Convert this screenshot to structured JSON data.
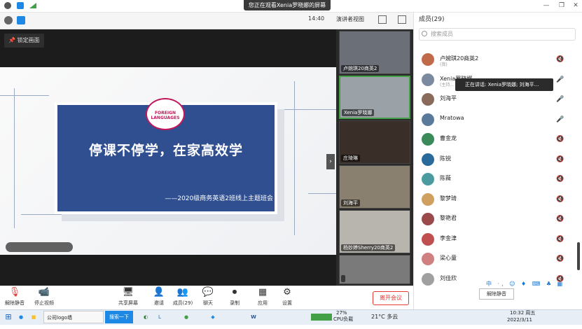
{
  "topbar": {
    "share_banner": "您正在观看Xenia罗晓娜的屏幕",
    "time": "14:40",
    "view_mode": "演讲者视图",
    "members_title": "成员(29)"
  },
  "stage": {
    "lock_label": "锁定画面",
    "slide_title": "停课不停学，在家高效学",
    "slide_subtitle": "——2020级商务英语2班线上主题班会",
    "logo_text": "FOREIGN LANGUAGES"
  },
  "filmstrip": [
    {
      "name": "卢婉琪20商英2"
    },
    {
      "name": "Xenia罗晓娜"
    },
    {
      "name": "庄琦琳"
    },
    {
      "name": "刘海平"
    },
    {
      "name": "杨妙婷Sherry20商英2"
    },
    {
      "name": ""
    }
  ],
  "bottombar": {
    "mute": "解除静音",
    "video": "停止视频",
    "share": "共享屏幕",
    "invite": "邀请",
    "members": "成员(29)",
    "chat": "聊天",
    "record": "录制",
    "apps": "应用",
    "settings": "设置",
    "leave": "离开会议"
  },
  "panel": {
    "search_placeholder": "搜索成员",
    "speaking": "正在讲话: Xenia罗晓娜; 刘海平...",
    "members": [
      {
        "name": "卢婉琪20商英2",
        "sub": "(我)",
        "color": "#c06a4a",
        "muted": true
      },
      {
        "name": "Xenia罗晓娜",
        "sub": "(主持...",
        "color": "#7c8aa0",
        "muted": false
      },
      {
        "name": "刘海平",
        "sub": "",
        "color": "#8a6a5a",
        "muted": false
      },
      {
        "name": "Mratowa",
        "sub": "",
        "color": "#5a7a9a",
        "muted": false
      },
      {
        "name": "曹金龙",
        "sub": "",
        "color": "#3a8a5a",
        "muted": true
      },
      {
        "name": "陈锐",
        "sub": "",
        "color": "#2a6a9a",
        "muted": true
      },
      {
        "name": "陈薇",
        "sub": "",
        "color": "#4a9aa0",
        "muted": true
      },
      {
        "name": "黎梦琦",
        "sub": "",
        "color": "#d0a060",
        "muted": true
      },
      {
        "name": "黎艳君",
        "sub": "",
        "color": "#9a4a4a",
        "muted": true
      },
      {
        "name": "李金津",
        "sub": "",
        "color": "#c05050",
        "muted": true
      },
      {
        "name": "梁心童",
        "sub": "",
        "color": "#d08080",
        "muted": true
      },
      {
        "name": "刘佳欣",
        "sub": "",
        "color": "#a0a0a0",
        "muted": true
      }
    ],
    "unmute_all": "解除静音",
    "ime": "中 ·, ☺ ♦ ⌨ ♣ ▦"
  },
  "taskbar": {
    "search": "搜索一下",
    "window": "公司logo墙",
    "cpu": "27%",
    "cpu_label": "CPU负载",
    "weather": "21°C 多云",
    "time": "10:32 周五",
    "date": "2022/3/11"
  }
}
